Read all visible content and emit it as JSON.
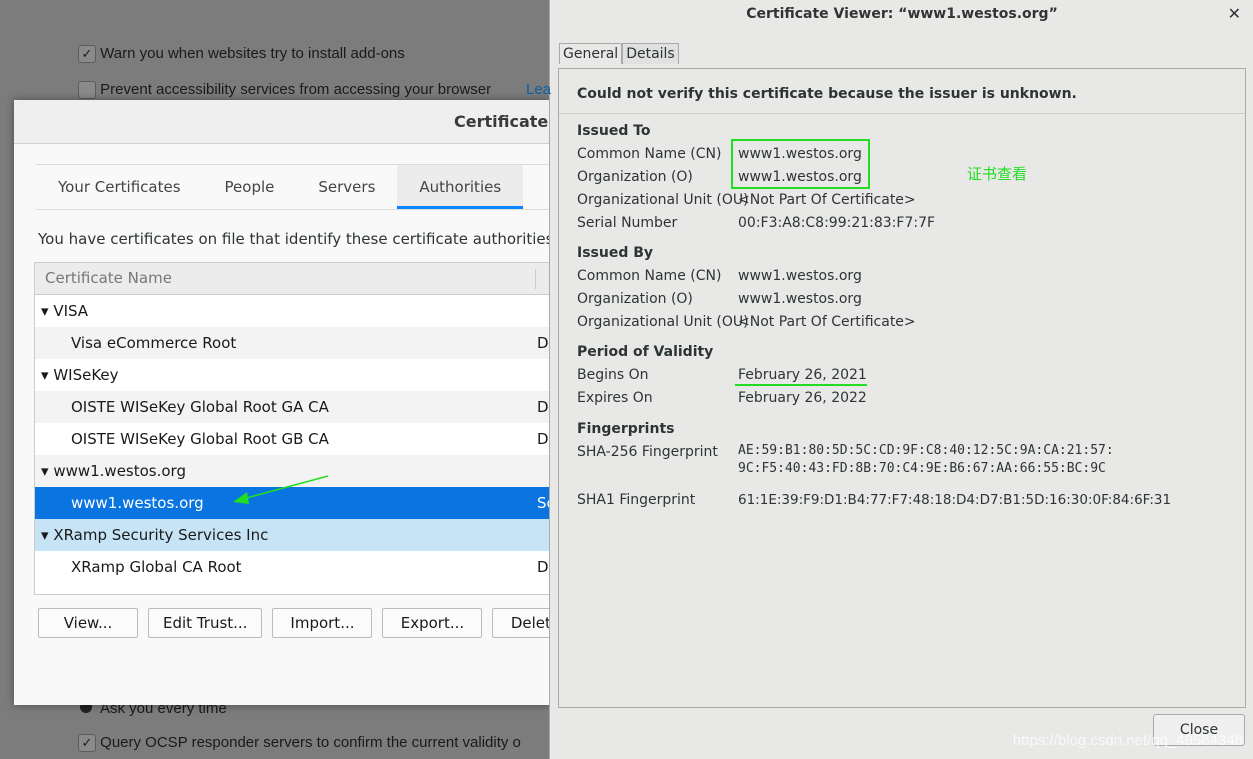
{
  "background": {
    "warn_addons": "Warn you when websites try to install add-ons",
    "prevent_access": "Prevent accessibility services from accessing your browser",
    "learn_more": "Lea",
    "ask_every_time": "Ask you every time",
    "query_ocsp": "Query OCSP responder servers to confirm the current validity o"
  },
  "manager": {
    "title": "Certificate M",
    "tabs": [
      {
        "label": "Your Certificates"
      },
      {
        "label": "People"
      },
      {
        "label": "Servers"
      },
      {
        "label": "Authorities"
      }
    ],
    "description": "You have certificates on file that identify these certificate authorities",
    "column": "Certificate Name",
    "rows": [
      {
        "name": "VISA",
        "col2": "",
        "group": true
      },
      {
        "name": "Visa eCommerce Root",
        "col2": "De"
      },
      {
        "name": "WISeKey",
        "col2": "",
        "group": true
      },
      {
        "name": "OISTE WISeKey Global Root GA CA",
        "col2": "De"
      },
      {
        "name": "OISTE WISeKey Global Root GB CA",
        "col2": "De"
      },
      {
        "name": "www1.westos.org",
        "col2": "",
        "group": true
      },
      {
        "name": "www1.westos.org",
        "col2": "So",
        "selected": true
      },
      {
        "name": "XRamp Security Services Inc",
        "col2": "",
        "group": true
      },
      {
        "name": "XRamp Global CA Root",
        "col2": "De"
      }
    ],
    "buttons": {
      "view": "View...",
      "edit_trust": "Edit Trust...",
      "import": "Import...",
      "export": "Export...",
      "delete": "Delete o"
    }
  },
  "viewer": {
    "title": "Certificate Viewer: “www1.westos.org”",
    "tabs": {
      "general": "General",
      "details": "Details"
    },
    "message": "Could not verify this certificate because the issuer is unknown.",
    "issued_to": {
      "heading": "Issued To",
      "cn_label": "Common Name (CN)",
      "cn": "www1.westos.org",
      "o_label": "Organization (O)",
      "o": "www1.westos.org",
      "ou_label": "Organizational Unit (OU)",
      "ou": "<Not Part Of Certificate>",
      "serial_label": "Serial Number",
      "serial": "00:F3:A8:C8:99:21:83:F7:7F"
    },
    "issued_by": {
      "heading": "Issued By",
      "cn_label": "Common Name (CN)",
      "cn": "www1.westos.org",
      "o_label": "Organization (O)",
      "o": "www1.westos.org",
      "ou_label": "Organizational Unit (OU)",
      "ou": "<Not Part Of Certificate>"
    },
    "validity": {
      "heading": "Period of Validity",
      "begins_label": "Begins On",
      "begins": "February 26, 2021",
      "expires_label": "Expires On",
      "expires": "February 26, 2022"
    },
    "fingerprints": {
      "heading": "Fingerprints",
      "sha256_label": "SHA-256 Fingerprint",
      "sha256_1": "AE:59:B1:80:5D:5C:CD:9F:C8:40:12:5C:9A:CA:21:57:",
      "sha256_2": "9C:F5:40:43:FD:8B:70:C4:9E:B6:67:AA:66:55:BC:9C",
      "sha1_label": "SHA1 Fingerprint",
      "sha1": "61:1E:39:F9:D1:B4:77:F7:48:18:D4:D7:B1:5D:16:30:0F:84:6F:31"
    },
    "close": "Close",
    "annotation": "证书查看"
  },
  "watermark": "https://blog.csdn.net/qq_49564346",
  "colors": {
    "accent": "#0a84ff",
    "selection": "#0a74e0",
    "annotation": "#22dd22"
  }
}
